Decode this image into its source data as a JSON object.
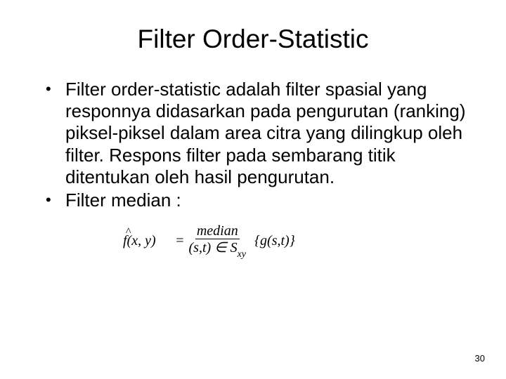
{
  "title": "Filter Order-Statistic",
  "bullets": [
    "Filter order-statistic adalah filter spasial yang responnya didasarkan pada pengurutan (ranking) piksel-piksel dalam area citra yang dilingkup oleh filter. Respons filter pada sembarang titik ditentukan oleh hasil pengurutan.",
    "Filter median :"
  ],
  "formula": {
    "lhs": "f(x, y)",
    "hat": "^",
    "eq": "=",
    "median_label": "median",
    "condition": "(s,t) ∈ S",
    "condition_sub": "xy",
    "rhs": "{g(s,t)}"
  },
  "page_number": "30"
}
